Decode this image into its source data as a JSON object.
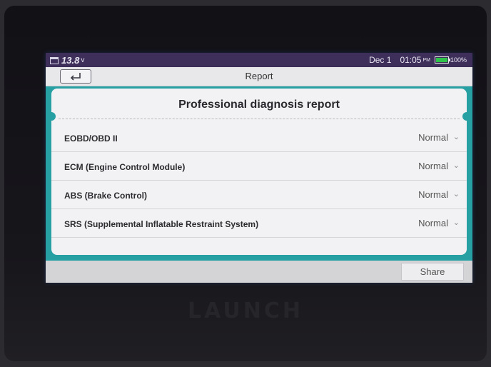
{
  "device": {
    "brand": "LAUNCH"
  },
  "statusbar": {
    "voltage": "13.8",
    "voltage_unit": "v",
    "date": "Dec 1",
    "time": "01:05",
    "ampm": "PM",
    "battery": "100%",
    "battery_color": "#2fc24b",
    "icons": [
      "calendar-icon",
      "battery-icon"
    ]
  },
  "titlebar": {
    "title": "Report",
    "back_icon": "back-arrow-icon"
  },
  "report": {
    "heading": "Professional diagnosis report",
    "rows": [
      {
        "label": "EOBD/OBD II",
        "status": "Normal"
      },
      {
        "label": "ECM (Engine Control Module)",
        "status": "Normal"
      },
      {
        "label": "ABS (Brake Control)",
        "status": "Normal"
      },
      {
        "label": "SRS (Supplemental Inflatable Restraint System)",
        "status": "Normal"
      }
    ],
    "accent_color": "#27a0a3"
  },
  "bottombar": {
    "share_label": "Share"
  }
}
